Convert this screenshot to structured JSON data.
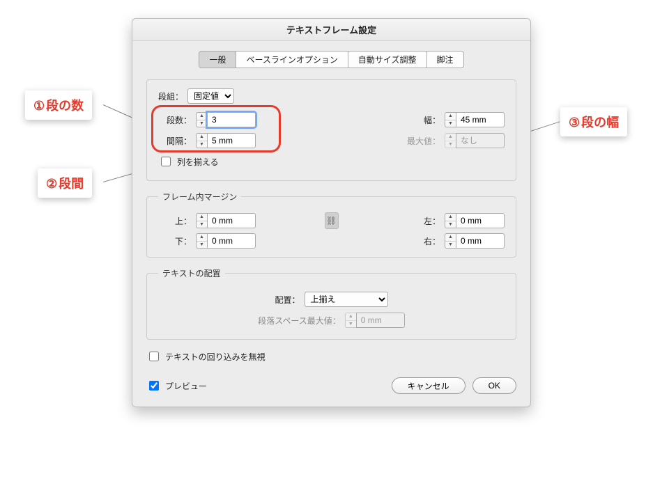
{
  "dialog": {
    "title": "テキストフレーム設定",
    "tabs": [
      "一般",
      "ベースラインオプション",
      "自動サイズ調整",
      "脚注"
    ],
    "columns": {
      "legend": "段組：",
      "type": "固定値",
      "count_label": "段数：",
      "count": "3",
      "gutter_label": "間隔：",
      "gutter": "5 mm",
      "width_label": "幅：",
      "width": "45 mm",
      "max_label": "最大値：",
      "max": "なし",
      "balance": "列を揃える"
    },
    "inset": {
      "legend": "フレーム内マージン",
      "top_label": "上：",
      "top": "0 mm",
      "bottom_label": "下：",
      "bottom": "0 mm",
      "left_label": "左：",
      "left": "0 mm",
      "right_label": "右：",
      "right": "0 mm"
    },
    "align": {
      "legend": "テキストの配置",
      "align_label": "配置：",
      "align_value": "上揃え",
      "para_label": "段落スペース最大値：",
      "para_value": "0 mm"
    },
    "ignore_wrap": "テキストの回り込みを無視",
    "preview": "プレビュー",
    "cancel": "キャンセル",
    "ok": "OK"
  },
  "callouts": {
    "c1": {
      "num": "①",
      "text": "段の数"
    },
    "c2": {
      "num": "②",
      "text": "段間"
    },
    "c3": {
      "num": "③",
      "text": "段の幅"
    }
  }
}
